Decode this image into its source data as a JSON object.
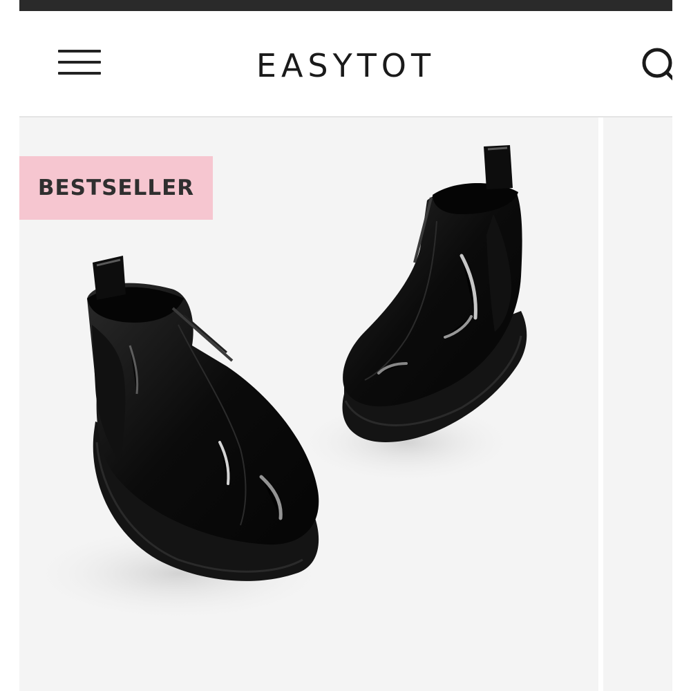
{
  "header": {
    "brand": "EASYTOT",
    "menu_icon": "hamburger-menu-icon",
    "search_icon": "search-icon"
  },
  "product": {
    "badge": "BESTSELLER",
    "image_subject": "black patent leather chelsea boots",
    "badge_color": "#f6c6d0"
  }
}
